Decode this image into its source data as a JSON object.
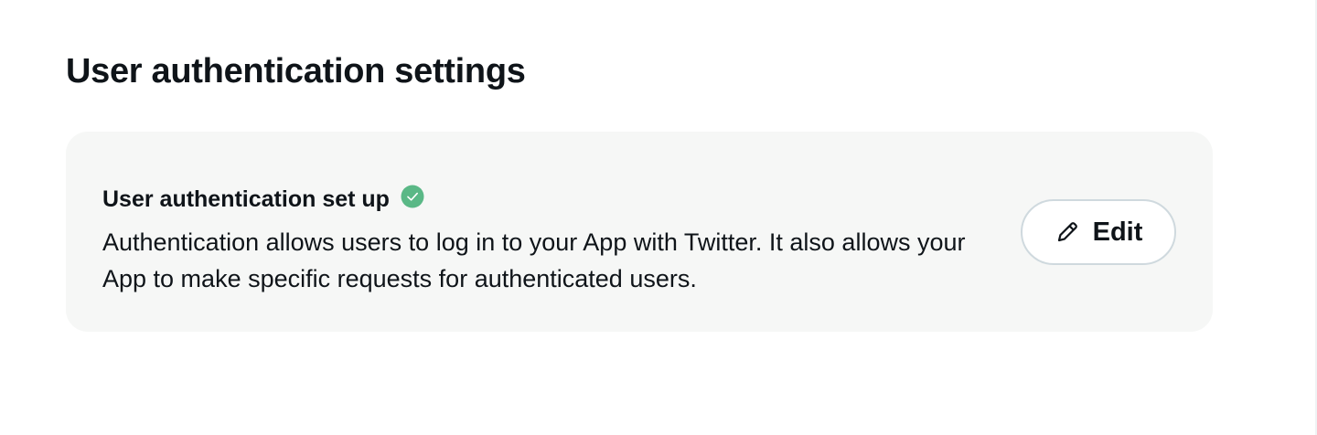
{
  "section": {
    "title": "User authentication settings"
  },
  "auth_card": {
    "heading": "User authentication set up",
    "status_icon": "check-circle-icon",
    "description": "Authentication allows users to log in to your App with Twitter. It also allows your App to make specific requests for authenticated users.",
    "edit_button": {
      "label": "Edit",
      "icon": "pencil-icon"
    }
  },
  "colors": {
    "card_background": "#f6f7f6",
    "success_green": "#5ab886",
    "text": "#0f1419",
    "button_border": "#cfd9de"
  }
}
